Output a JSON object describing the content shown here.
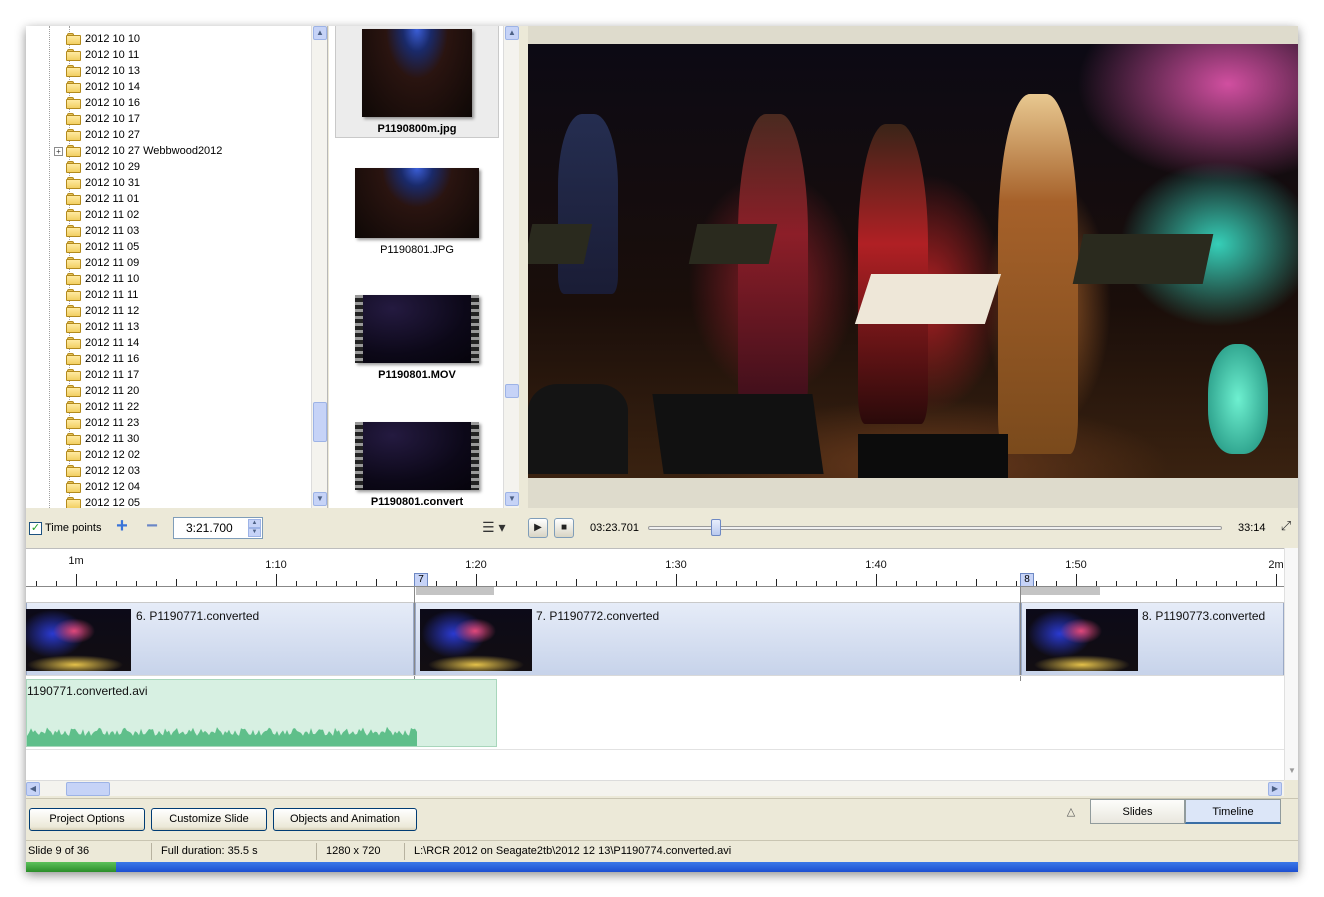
{
  "folder_tree": {
    "items": [
      {
        "label": "2012 10 10"
      },
      {
        "label": "2012 10 11"
      },
      {
        "label": "2012 10 13"
      },
      {
        "label": "2012 10 14"
      },
      {
        "label": "2012 10 16"
      },
      {
        "label": "2012 10 17"
      },
      {
        "label": "2012 10 27"
      },
      {
        "label": "2012 10 27 Webbwood2012",
        "expandable": true
      },
      {
        "label": "2012 10 29"
      },
      {
        "label": "2012 10 31"
      },
      {
        "label": "2012 11 01"
      },
      {
        "label": "2012 11 02"
      },
      {
        "label": "2012 11 03"
      },
      {
        "label": "2012 11 05"
      },
      {
        "label": "2012 11 09"
      },
      {
        "label": "2012 11 10"
      },
      {
        "label": "2012 11 11"
      },
      {
        "label": "2012 11 12"
      },
      {
        "label": "2012 11 13"
      },
      {
        "label": "2012 11 14"
      },
      {
        "label": "2012 11 16"
      },
      {
        "label": "2012 11 17"
      },
      {
        "label": "2012 11 20"
      },
      {
        "label": "2012 11 22"
      },
      {
        "label": "2012 11 23"
      },
      {
        "label": "2012 11 30"
      },
      {
        "label": "2012 12 02"
      },
      {
        "label": "2012 12 03"
      },
      {
        "label": "2012 12 04"
      },
      {
        "label": "2012 12 05"
      }
    ]
  },
  "thumbnails": [
    {
      "name": "P1190800m.jpg",
      "selected": true,
      "video": false
    },
    {
      "name": "P1190801.JPG",
      "selected": false,
      "video": false
    },
    {
      "name": "P1190801.MOV",
      "selected": false,
      "video": true
    },
    {
      "name": "P1190801.convert",
      "selected": false,
      "video": true
    }
  ],
  "transport": {
    "time_points_label": "Time points",
    "time_points_checked": true,
    "time_value": "3:21.700",
    "current_time": "03:23.701",
    "total_time": "33:14",
    "position_fraction": 0.11
  },
  "timeline": {
    "ruler_labels": [
      "1m",
      "1:10",
      "1:20",
      "1:30",
      "1:40",
      "1:50",
      "2m"
    ],
    "markers": [
      "7",
      "8"
    ],
    "clips": [
      {
        "label": "6. P1190771.converted"
      },
      {
        "label": "7. P1190772.converted"
      },
      {
        "label": "8. P1190773.converted"
      }
    ],
    "audio_label": "1190771.converted.avi"
  },
  "bottom_buttons": {
    "project_options": "Project Options",
    "customize_slide": "Customize Slide",
    "objects_animation": "Objects and Animation"
  },
  "view_tabs": {
    "slides": "Slides",
    "timeline": "Timeline",
    "active": "Timeline"
  },
  "status": {
    "slide": "Slide 9 of 36",
    "duration": "Full duration: 35.5 s",
    "resolution": "1280 x 720",
    "path": "L:\\RCR 2012 on Seagate2tb\\2012 12 13\\P1190774.converted.avi"
  },
  "colors": {
    "window_bg": "#ece9d8",
    "clip_bg": "#c7d3ea",
    "audio_bg": "#d7f0e2",
    "waveform": "#5fbf8a",
    "active_tab": "#dce6f8"
  }
}
